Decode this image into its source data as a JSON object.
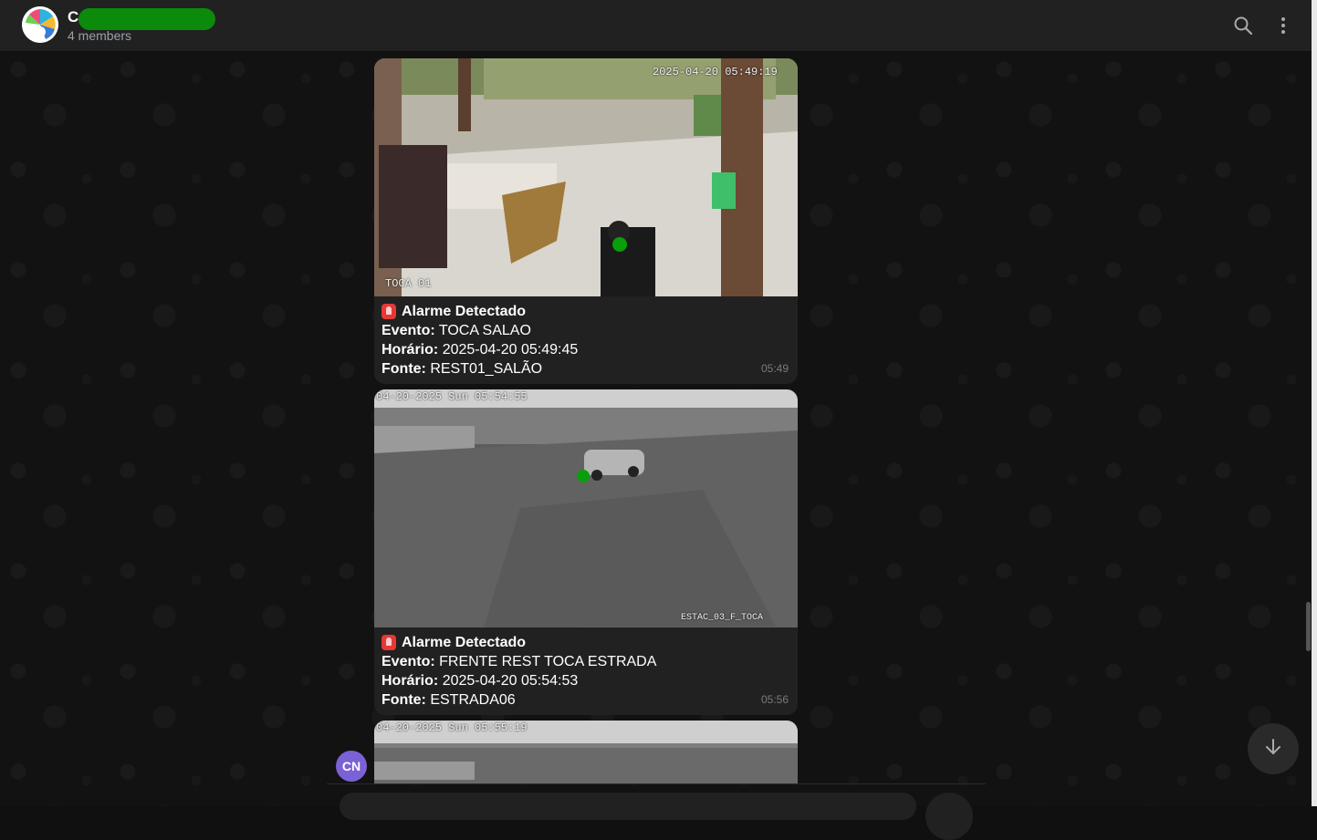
{
  "header": {
    "title": "C",
    "members": "4 members",
    "icons": [
      "search-icon",
      "more-vertical-icon"
    ]
  },
  "messages": [
    {
      "camera_timestamp": "2025-04-20 05:49:19",
      "camera_label": "TOCA 01",
      "heading": "Alarme Detectado",
      "event_label": "Evento:",
      "event_value": "TOCA SALAO",
      "time_label": "Horário:",
      "time_value": "2025-04-20 05:49:45",
      "source_label": "Fonte:",
      "source_value": "REST01_SALÃO",
      "sent_time": "05:49"
    },
    {
      "camera_timestamp": "04-20-2025 Sun 05:54:55",
      "camera_label": "ESTAC_03_F_TOCA",
      "heading": "Alarme Detectado",
      "event_label": "Evento:",
      "event_value": "FRENTE REST TOCA ESTRADA",
      "time_label": "Horário:",
      "time_value": "2025-04-20 05:54:53",
      "source_label": "Fonte:",
      "source_value": "ESTRADA06",
      "sent_time": "05:56"
    },
    {
      "camera_timestamp": "04-20-2025 Sun 05:55:19"
    }
  ],
  "sender_avatar": "CN",
  "colors": {
    "header_bg": "#212121",
    "bubble_bg": "#212121",
    "avatar_bg": "#7b61d6",
    "alarm_red": "#e53935"
  }
}
